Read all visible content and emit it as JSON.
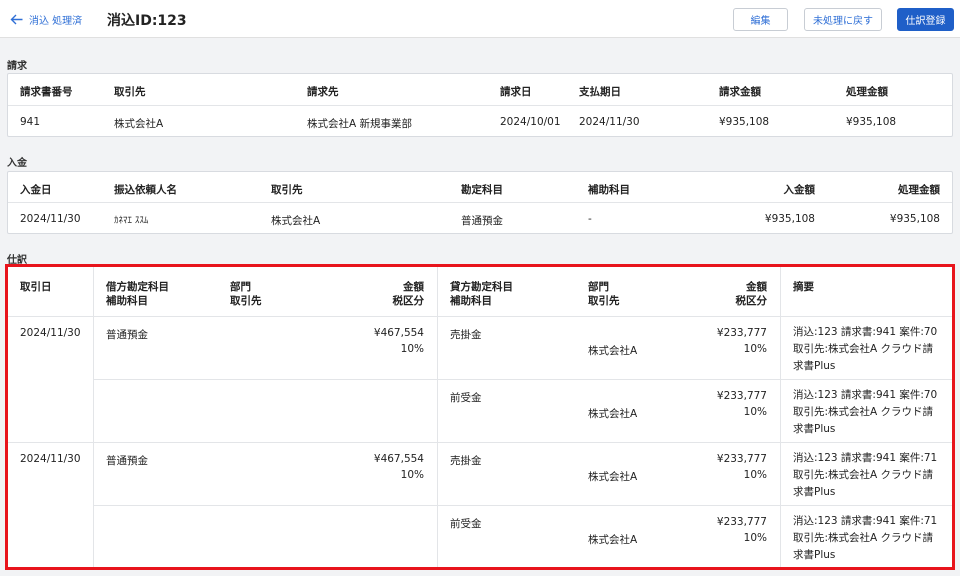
{
  "header": {
    "back_label": "消込 処理済",
    "title": "消込ID:123",
    "edit_label": "編集",
    "revert_label": "未処理に戻す",
    "register_label": "仕訳登録"
  },
  "invoice": {
    "section_label": "請求",
    "headers": [
      "請求書番号",
      "取引先",
      "請求先",
      "請求日",
      "支払期日",
      "請求金額",
      "処理金額"
    ],
    "row": [
      "941",
      "株式会社A",
      "株式会社A 新規事業部",
      "2024/10/01",
      "2024/11/30",
      "¥935,108",
      "¥935,108"
    ]
  },
  "payment": {
    "section_label": "入金",
    "headers": [
      "入金日",
      "振込依頼人名",
      "取引先",
      "勘定科目",
      "補助科目",
      "入金額",
      "処理金額"
    ],
    "row": [
      "2024/11/30",
      "ｶﾈﾏｴ ｽｽﾑ",
      "株式会社A",
      "普通預金",
      "-",
      "¥935,108",
      "¥935,108"
    ]
  },
  "journal": {
    "section_label": "仕訳",
    "headers": {
      "date": "取引日",
      "debit_account": "借方勘定科目",
      "debit_sub": "補助科目",
      "debit_dept": "部門",
      "debit_partner": "取引先",
      "debit_amount": "金額",
      "debit_tax": "税区分",
      "credit_account": "貸方勘定科目",
      "credit_sub": "補助科目",
      "credit_dept": "部門",
      "credit_partner": "取引先",
      "credit_amount": "金額",
      "credit_tax": "税区分",
      "memo": "摘要"
    },
    "entries": [
      {
        "date": "2024/11/30",
        "debit_account": "普通預金",
        "debit_amount": "¥467,554",
        "debit_tax": "10%",
        "lines": [
          {
            "credit_account": "売掛金",
            "credit_partner": "株式会社A",
            "credit_amount": "¥233,777",
            "credit_tax": "10%",
            "memo": "消込:123 請求書:941 案件:70 取引先:株式会社A クラウド請求書Plus"
          },
          {
            "credit_account": "前受金",
            "credit_partner": "株式会社A",
            "credit_amount": "¥233,777",
            "credit_tax": "10%",
            "memo": "消込:123 請求書:941 案件:70 取引先:株式会社A クラウド請求書Plus"
          }
        ]
      },
      {
        "date": "2024/11/30",
        "debit_account": "普通預金",
        "debit_amount": "¥467,554",
        "debit_tax": "10%",
        "lines": [
          {
            "credit_account": "売掛金",
            "credit_partner": "株式会社A",
            "credit_amount": "¥233,777",
            "credit_tax": "10%",
            "memo": "消込:123 請求書:941 案件:71 取引先:株式会社A クラウド請求書Plus"
          },
          {
            "credit_account": "前受金",
            "credit_partner": "株式会社A",
            "credit_amount": "¥233,777",
            "credit_tax": "10%",
            "memo": "消込:123 請求書:941 案件:71 取引先:株式会社A クラウド請求書Plus"
          }
        ]
      }
    ]
  },
  "colors": {
    "accent": "#1f5fc8",
    "link": "#2f6fd6",
    "highlight": "#e8141c"
  }
}
